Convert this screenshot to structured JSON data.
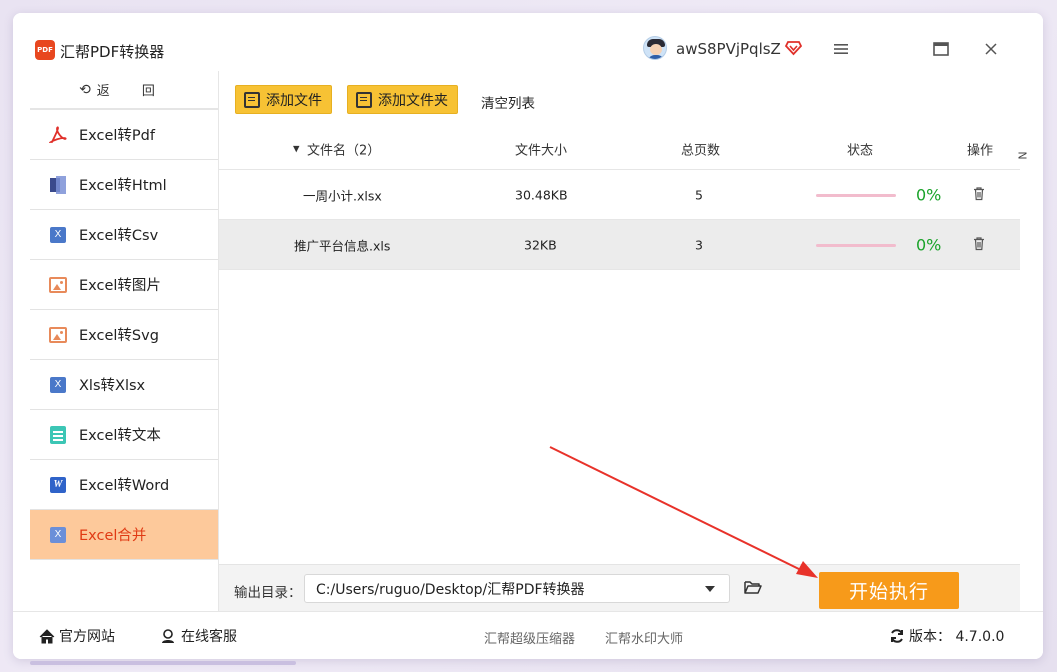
{
  "app": {
    "title": "汇帮PDF转换器",
    "logo_text": "PDF",
    "username": "awS8PVjPqlsZ"
  },
  "sidebar": {
    "back_label": "返 回",
    "items": [
      {
        "label": "Excel转Pdf",
        "icon": "pdf-icon"
      },
      {
        "label": "Excel转Html",
        "icon": "html-icon"
      },
      {
        "label": "Excel转Csv",
        "icon": "excel-icon"
      },
      {
        "label": "Excel转图片",
        "icon": "image-icon"
      },
      {
        "label": "Excel转Svg",
        "icon": "image-icon"
      },
      {
        "label": "Xls转Xlsx",
        "icon": "excel-icon"
      },
      {
        "label": "Excel转文本",
        "icon": "text-icon"
      },
      {
        "label": "Excel转Word",
        "icon": "word-icon"
      },
      {
        "label": "Excel合并",
        "icon": "excel-icon",
        "active": true
      }
    ]
  },
  "toolbar": {
    "add_file": "添加文件",
    "add_folder": "添加文件夹",
    "clear_list": "清空列表"
  },
  "table": {
    "headers": {
      "filename": "文件名（2）",
      "size": "文件大小",
      "pages": "总页数",
      "status": "状态",
      "action": "操作",
      "cut": "N"
    },
    "rows": [
      {
        "name": "一周小计.xlsx",
        "size": "30.48KB",
        "pages": "5",
        "progress": 0,
        "pct": "0%"
      },
      {
        "name": "推广平台信息.xls",
        "size": "32KB",
        "pages": "3",
        "progress": 0,
        "pct": "0%"
      }
    ]
  },
  "output": {
    "label": "输出目录：",
    "path": "C:/Users/ruguo/Desktop/汇帮PDF转换器"
  },
  "start_button": "开始执行",
  "bottom": {
    "website": "官方网站",
    "service": "在线客服",
    "link1": "汇帮超级压缩器",
    "link2": "汇帮水印大师",
    "version": "版本：  4.7.0.0"
  },
  "colors": {
    "accent": "#f79a1a",
    "toolbar_button": "#f7c234",
    "active_item_bg": "#fdc99b",
    "active_item_text": "#e03a14",
    "progress_percent": "#1aa32a",
    "annotation_arrow": "#e8322a"
  }
}
